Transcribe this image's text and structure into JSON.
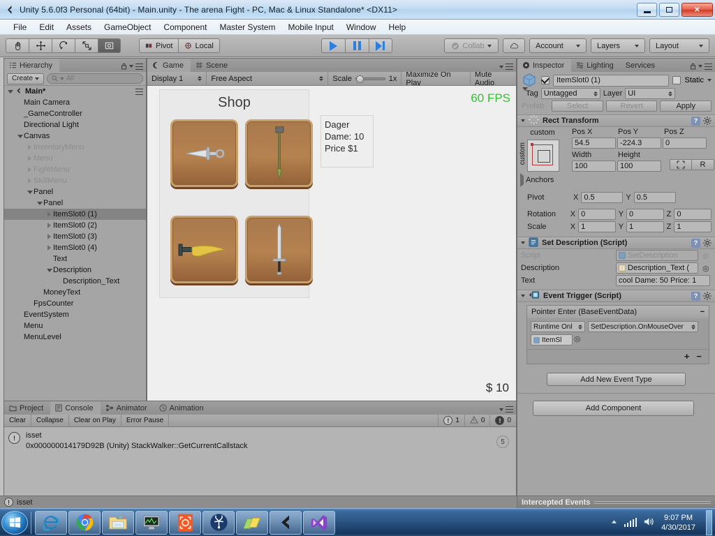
{
  "window": {
    "title": "Unity 5.6.0f3 Personal (64bit) - Main.unity - The arena Fight - PC, Mac & Linux Standalone* <DX11>",
    "minimize_label": "minimize",
    "maximize_label": "maximize",
    "close_label": "✕"
  },
  "menubar": {
    "items": [
      "File",
      "Edit",
      "Assets",
      "GameObject",
      "Component",
      "Master System",
      "Mobile Input",
      "Window",
      "Help"
    ]
  },
  "toolbar": {
    "tools": [
      "hand-tool",
      "move-tool",
      "rotate-tool",
      "scale-tool",
      "rect-tool"
    ],
    "pivot_label": "Pivot",
    "local_label": "Local",
    "play_label": "play",
    "pause_label": "pause",
    "step_label": "step",
    "collab_label": "Collab",
    "cloud_label": "cloud",
    "account_label": "Account",
    "layers_label": "Layers",
    "layout_label": "Layout"
  },
  "hierarchy": {
    "tab_label": "Hierarchy",
    "create_label": "Create",
    "search_placeholder": "All",
    "scene_name": "Main*",
    "items": [
      {
        "label": "Main Camera",
        "depth": 1,
        "arrow": "none",
        "dim": false,
        "selected": false
      },
      {
        "label": "_GameController",
        "depth": 1,
        "arrow": "none",
        "dim": false,
        "selected": false
      },
      {
        "label": "Directional Light",
        "depth": 1,
        "arrow": "none",
        "dim": false,
        "selected": false
      },
      {
        "label": "Canvas",
        "depth": 1,
        "arrow": "down",
        "dim": false,
        "selected": false
      },
      {
        "label": "InventoryMenu",
        "depth": 2,
        "arrow": "right",
        "dim": true,
        "selected": false
      },
      {
        "label": "Menu",
        "depth": 2,
        "arrow": "right",
        "dim": true,
        "selected": false
      },
      {
        "label": "FightMenu",
        "depth": 2,
        "arrow": "right",
        "dim": true,
        "selected": false
      },
      {
        "label": "SkillMenu",
        "depth": 2,
        "arrow": "right",
        "dim": true,
        "selected": false
      },
      {
        "label": "Panel",
        "depth": 2,
        "arrow": "down",
        "dim": false,
        "selected": false
      },
      {
        "label": "Panel",
        "depth": 3,
        "arrow": "down",
        "dim": false,
        "selected": false
      },
      {
        "label": "ItemSlot0 (1)",
        "depth": 4,
        "arrow": "right",
        "dim": false,
        "selected": true
      },
      {
        "label": "ItemSlot0 (2)",
        "depth": 4,
        "arrow": "right",
        "dim": false,
        "selected": false
      },
      {
        "label": "ItemSlot0 (3)",
        "depth": 4,
        "arrow": "right",
        "dim": false,
        "selected": false
      },
      {
        "label": "ItemSlot0 (4)",
        "depth": 4,
        "arrow": "right",
        "dim": false,
        "selected": false
      },
      {
        "label": "Text",
        "depth": 4,
        "arrow": "none",
        "dim": false,
        "selected": false
      },
      {
        "label": "Description",
        "depth": 4,
        "arrow": "down",
        "dim": false,
        "selected": false
      },
      {
        "label": "Description_Text",
        "depth": 5,
        "arrow": "none",
        "dim": false,
        "selected": false
      },
      {
        "label": "MoneyText",
        "depth": 3,
        "arrow": "none",
        "dim": false,
        "selected": false
      },
      {
        "label": "FpsCounter",
        "depth": 2,
        "arrow": "none",
        "dim": false,
        "selected": false
      },
      {
        "label": "EventSystem",
        "depth": 1,
        "arrow": "none",
        "dim": false,
        "selected": false
      },
      {
        "label": "Menu",
        "depth": 1,
        "arrow": "none",
        "dim": false,
        "selected": false
      },
      {
        "label": "MenuLevel",
        "depth": 1,
        "arrow": "none",
        "dim": false,
        "selected": false
      }
    ]
  },
  "gameview": {
    "tab_game": "Game",
    "tab_scene": "Scene",
    "display": "Display 1",
    "aspect": "Free Aspect",
    "scale_label": "Scale",
    "scale_value": "1x",
    "maximize_on_play": "Maximize On Play",
    "mute_audio": "Mute Audio",
    "shop_title": "Shop",
    "fps": "60 FPS",
    "money": "$ 10",
    "description": [
      "Dager",
      "Dame: 10",
      "Price $1"
    ],
    "slots": [
      {
        "name": "item-slot-dagger",
        "weapon": "dagger"
      },
      {
        "name": "item-slot-spear",
        "weapon": "spear"
      },
      {
        "name": "item-slot-khopesh",
        "weapon": "khopesh"
      },
      {
        "name": "item-slot-sword",
        "weapon": "sword"
      }
    ]
  },
  "inspector": {
    "tab_inspector": "Inspector",
    "tab_lighting": "Lighting",
    "tab_services": "Services",
    "object_name": "ItemSlot0 (1)",
    "static_label": "Static",
    "tag_label": "Tag",
    "tag_value": "Untagged",
    "layer_label": "Layer",
    "layer_value": "UI",
    "prefab_label": "Prefab",
    "prefab_select": "Select",
    "prefab_revert": "Revert",
    "prefab_apply": "Apply",
    "rect_transform": {
      "title": "Rect Transform",
      "anchor_preset": "custom",
      "anchor_preset_v": "custom",
      "pos_x_label": "Pos X",
      "pos_y_label": "Pos Y",
      "pos_z_label": "Pos Z",
      "pos_x": "54.5",
      "pos_y": "-224.3",
      "pos_z": "0",
      "width_label": "Width",
      "height_label": "Height",
      "width": "100",
      "height": "100",
      "blueprint_label": "",
      "raw_label": "R",
      "anchors_label": "Anchors",
      "pivot_label": "Pivot",
      "pivot_x": "0.5",
      "pivot_y": "0.5",
      "rotation_label": "Rotation",
      "rot_x": "0",
      "rot_y": "0",
      "rot_z": "0",
      "scale_label": "Scale",
      "scale_x": "1",
      "scale_y": "1",
      "scale_z": "1",
      "x_label": "X",
      "y_label": "Y",
      "z_label": "Z"
    },
    "set_description": {
      "title": "Set Description (Script)",
      "script_label": "Script",
      "script_value": "SetDescription",
      "description_label": "Description",
      "description_value": "Description_Text (",
      "text_label": "Text",
      "text_value": "cool Dame: 50  Price: 1"
    },
    "event_trigger": {
      "title": "Event Trigger (Script)",
      "entry_title": "Pointer Enter (BaseEventData)",
      "remove_entry": "−",
      "runtime_label": "Runtime Onl",
      "function_label": "SetDescription.OnMouseOver",
      "object_label": "ItemSl",
      "add_btn": "+",
      "remove_btn": "−"
    },
    "add_event_type": "Add New Event Type",
    "add_component": "Add Component",
    "intercepted_events": "Intercepted Events"
  },
  "console": {
    "tab_project": "Project",
    "tab_console": "Console",
    "tab_animator": "Animator",
    "tab_animation": "Animation",
    "clear_label": "Clear",
    "collapse_label": "Collapse",
    "clear_on_play_label": "Clear on Play",
    "error_pause_label": "Error Pause",
    "count_error": "1",
    "count_warn": "0",
    "count_info": "0",
    "entry_line1": "isset",
    "entry_line2": "0x000000014179D92B (Unity) StackWalker::GetCurrentCallstack",
    "entry_count": "5",
    "status_text": "isset"
  },
  "taskbar": {
    "apps": [
      "internet-explorer",
      "google-chrome",
      "file-explorer",
      "media-monitor",
      "unity-remote",
      "sourcetree",
      "files-app",
      "unity-editor",
      "visual-studio"
    ],
    "time": "9:07 PM",
    "date": "4/30/2017"
  },
  "colors": {
    "accent_blue": "#2a7fe0",
    "fps_green": "#2ec62e",
    "panel_gray": "#a5a5a5",
    "slot_brown": "#b5824f"
  }
}
